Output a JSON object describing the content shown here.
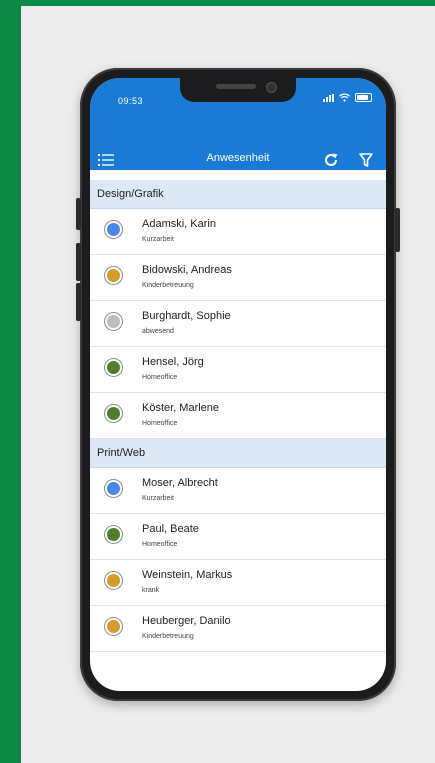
{
  "colors": {
    "accent": "#1a7bd6",
    "frame_green": "#0b8a4a"
  },
  "status_bar": {
    "time": "09:53",
    "icons": [
      "signal-icon",
      "wifi-icon",
      "battery-icon"
    ]
  },
  "nav": {
    "title": "Anwesenheit",
    "icons": [
      "list-menu-icon",
      "refresh-icon",
      "filter-icon"
    ]
  },
  "groups": [
    {
      "name": "Design/Grafik",
      "people": [
        {
          "name": "Adamski, Karin",
          "status": "Kurzarbeit",
          "color": "#4a86e8"
        },
        {
          "name": "Bidowski, Andreas",
          "status": "Kinderbetreuung",
          "color": "#d49a2a"
        },
        {
          "name": "Burghardt, Sophie",
          "status": "abwesend",
          "color": "#bdbdbd"
        },
        {
          "name": "Hensel, Jörg",
          "status": "Homeoffice",
          "color": "#4f7f2e"
        },
        {
          "name": "Köster, Marlene",
          "status": "Homeoffice",
          "color": "#4f7f2e"
        }
      ]
    },
    {
      "name": "Print/Web",
      "people": [
        {
          "name": "Moser, Albrecht",
          "status": "Kurzarbeit",
          "color": "#4a86e8"
        },
        {
          "name": "Paul, Beate",
          "status": "Homeoffice",
          "color": "#4f7f2e"
        },
        {
          "name": "Weinstein, Markus",
          "status": "krank",
          "color": "#d49a2a"
        },
        {
          "name": "Heuberger, Danilo",
          "status": "Kinderbetreuung",
          "color": "#d49a2a"
        }
      ]
    }
  ]
}
